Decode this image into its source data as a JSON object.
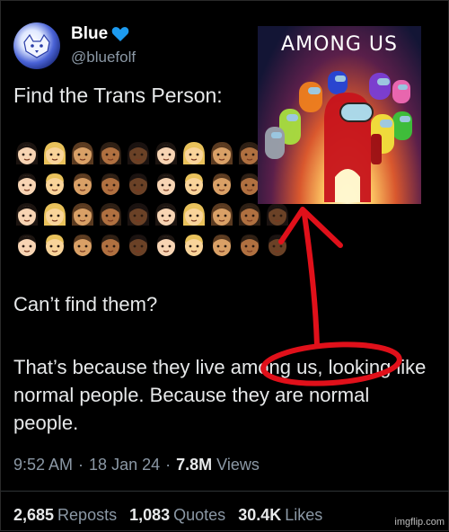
{
  "tweet": {
    "display_name": "Blue",
    "handle": "@bluefolf",
    "headline": "Find the Trans Person:",
    "question": "Can’t find them?",
    "body_1": "That’s because they live ",
    "body_highlight": "among us,",
    "body_2": " looking like normal people. Because they are normal people.",
    "time": "9:52 AM",
    "date": "18 Jan 24",
    "views_count": "7.8M",
    "views_label": "Views",
    "reposts_count": "2,685",
    "reposts_label": "Reposts",
    "quotes_count": "1,083",
    "quotes_label": "Quotes",
    "likes_count": "30.4K",
    "likes_label": "Likes"
  },
  "image": {
    "title": "AMONG US"
  },
  "watermark": "imgflip.com",
  "colors": {
    "background": "#000000",
    "heart": "#1d9bf0",
    "annotation": "#e0101a",
    "secondary_text": "#8b98a5"
  },
  "emoji_grid": [
    [
      "woman-dark-hair",
      "woman-blonde",
      "woman-medium",
      "woman-medium-dark",
      "woman-dark",
      "woman-dark-hair",
      "woman-blonde",
      "woman-medium",
      "woman-medium-dark"
    ],
    [
      "man-dark-hair",
      "man-blonde",
      "man-medium",
      "man-medium-dark",
      "man-dark",
      "man-dark-hair",
      "man-blonde",
      "man-medium",
      "man-medium-dark"
    ],
    [
      "woman-dark-hair",
      "woman-blonde",
      "woman-medium",
      "woman-medium-dark",
      "woman-dark",
      "woman-dark-hair",
      "woman-blonde",
      "woman-medium",
      "woman-medium-dark",
      "woman-dark"
    ],
    [
      "man-dark-hair",
      "man-blonde",
      "man-medium",
      "man-medium-dark",
      "man-dark",
      "man-dark-hair",
      "man-blonde",
      "man-medium",
      "man-medium-dark",
      "man-dark"
    ]
  ]
}
